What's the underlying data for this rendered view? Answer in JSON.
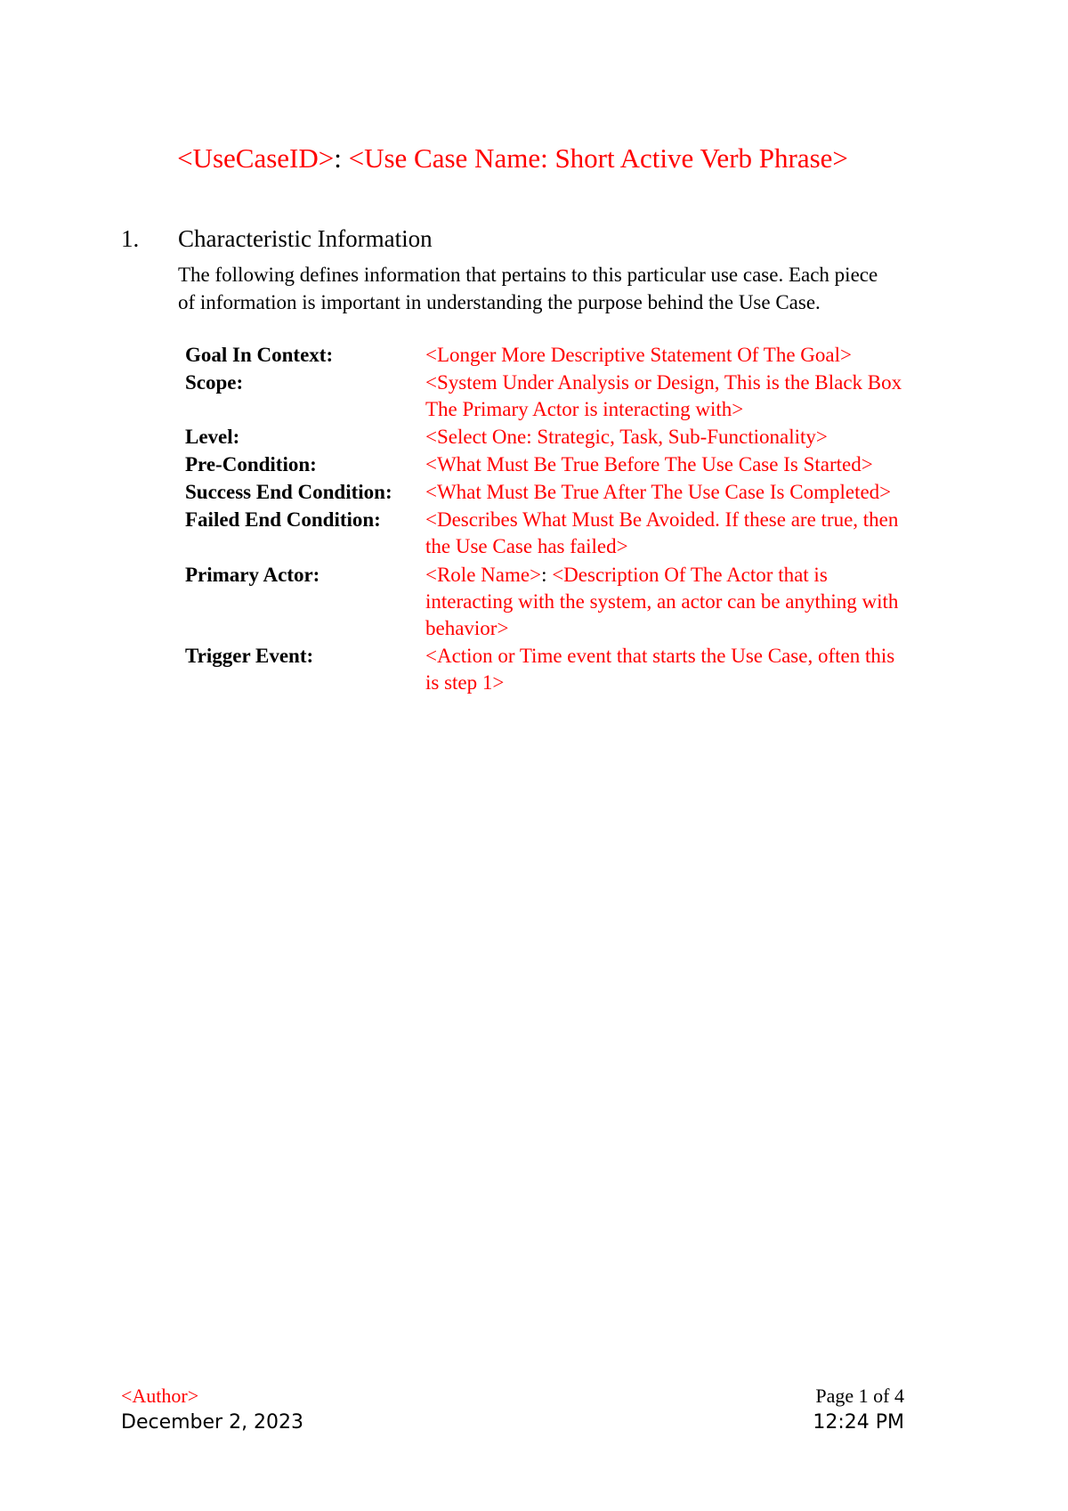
{
  "document": {
    "title_prefix": "<UseCaseID>",
    "title_separator": ":",
    "title_main": "<Use Case Name: Short Active Verb Phrase>",
    "accent_color": "#ff0000",
    "text_color": "#000000"
  },
  "section": {
    "number": "1.",
    "heading": "Characteristic Information",
    "intro": "The following defines information that pertains to this particular use case. Each piece of information is important in understanding the purpose behind the Use Case."
  },
  "attributes": [
    {
      "label": "Goal In Context:",
      "value": "<Longer More Descriptive Statement Of The Goal>"
    },
    {
      "label": "Scope:",
      "value": "<System Under Analysis or Design, This is the Black Box The Primary Actor is interacting with>"
    },
    {
      "label": "Level:",
      "value": "<Select One: Strategic, Task, Sub-Functionality>"
    },
    {
      "label": "Pre-Condition:",
      "value": "<What Must Be True Before The Use Case Is Started>"
    },
    {
      "label": "Success End Condition:",
      "value": "<What Must Be True After The Use Case Is Completed>"
    },
    {
      "label": "Failed End Condition:",
      "value": "<Describes What Must Be Avoided.  If these are true, then the Use Case has failed>"
    },
    {
      "label": "Primary Actor:",
      "value_part1": "<Role Name>",
      "value_separator": ":",
      "value_part2": "<Description Of The Actor that is interacting with the system, an actor can be anything with behavior>"
    },
    {
      "label": "Trigger Event:",
      "value": "<Action or Time event that starts the Use Case, often this is step 1>"
    }
  ],
  "footer": {
    "author": "<Author>",
    "date": "December 2, 2023",
    "page": "Page 1 of 4",
    "time": "12:24 PM"
  }
}
